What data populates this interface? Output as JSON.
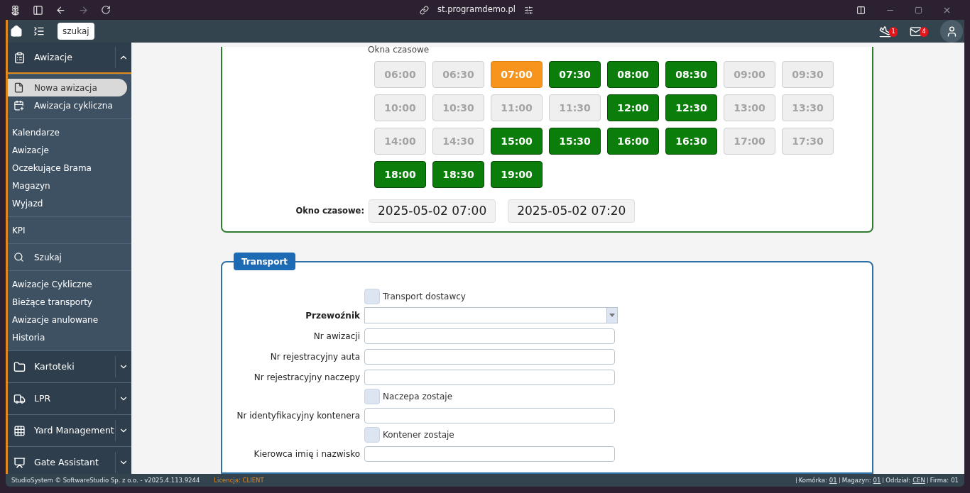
{
  "browser": {
    "url": "st.programdemo.pl"
  },
  "header": {
    "search_button": "szukaj",
    "notifications": [
      {
        "badge": "1"
      },
      {
        "badge": "4"
      }
    ]
  },
  "sidebar": {
    "groups": [
      {
        "items": [
          {
            "kind": "section",
            "label": "Awizacje",
            "expanded": true
          }
        ]
      },
      {
        "items": [
          {
            "kind": "icon_link",
            "label": "Nowa awizacja",
            "selected": true
          },
          {
            "kind": "icon_link",
            "label": "Awizacja cykliczna",
            "selected": false
          }
        ]
      },
      {
        "items": [
          {
            "kind": "link",
            "label": "Kalendarze",
            "selected": false
          },
          {
            "kind": "link",
            "label": "Awizacje",
            "selected": false
          },
          {
            "kind": "link",
            "label": "Oczekujące Brama",
            "selected": false
          },
          {
            "kind": "link",
            "label": "Magazyn",
            "selected": false
          },
          {
            "kind": "link",
            "label": "Wyjazd",
            "selected": false
          }
        ]
      },
      {
        "items": [
          {
            "kind": "link",
            "label": "KPI",
            "selected": false
          }
        ]
      },
      {
        "items": [
          {
            "kind": "icon_link",
            "label": "Szukaj",
            "selected": false
          }
        ]
      },
      {
        "items": [
          {
            "kind": "link",
            "label": "Awizacje Cykliczne",
            "selected": false
          },
          {
            "kind": "link",
            "label": "Bieżące transporty",
            "selected": false
          },
          {
            "kind": "link",
            "label": "Awizacje anulowane",
            "selected": false
          },
          {
            "kind": "link",
            "label": "Historia",
            "selected": false
          }
        ]
      },
      {
        "items": [
          {
            "kind": "section",
            "label": "Kartoteki",
            "expanded": false
          }
        ]
      },
      {
        "items": [
          {
            "kind": "section",
            "label": "LPR",
            "expanded": false
          }
        ]
      },
      {
        "items": [
          {
            "kind": "section",
            "label": "Yard Management",
            "expanded": false
          }
        ]
      },
      {
        "items": [
          {
            "kind": "section",
            "label": "Gate Assistant",
            "expanded": false
          }
        ]
      }
    ]
  },
  "time_windows": {
    "title": "Okna czasowe",
    "slots": [
      {
        "time": "06:00",
        "available": false,
        "selected": false
      },
      {
        "time": "06:30",
        "available": false,
        "selected": false
      },
      {
        "time": "07:00",
        "available": true,
        "selected": true
      },
      {
        "time": "07:30",
        "available": true,
        "selected": false
      },
      {
        "time": "08:00",
        "available": true,
        "selected": false
      },
      {
        "time": "08:30",
        "available": true,
        "selected": false
      },
      {
        "time": "09:00",
        "available": false,
        "selected": false
      },
      {
        "time": "09:30",
        "available": false,
        "selected": false
      },
      {
        "time": "10:00",
        "available": false,
        "selected": false
      },
      {
        "time": "10:30",
        "available": false,
        "selected": false
      },
      {
        "time": "11:00",
        "available": false,
        "selected": false
      },
      {
        "time": "11:30",
        "available": false,
        "selected": false
      },
      {
        "time": "12:00",
        "available": true,
        "selected": false
      },
      {
        "time": "12:30",
        "available": true,
        "selected": false
      },
      {
        "time": "13:00",
        "available": false,
        "selected": false
      },
      {
        "time": "13:30",
        "available": false,
        "selected": false
      },
      {
        "time": "14:00",
        "available": false,
        "selected": false
      },
      {
        "time": "14:30",
        "available": false,
        "selected": false
      },
      {
        "time": "15:00",
        "available": true,
        "selected": false
      },
      {
        "time": "15:30",
        "available": true,
        "selected": false
      },
      {
        "time": "16:00",
        "available": true,
        "selected": false
      },
      {
        "time": "16:30",
        "available": true,
        "selected": false
      },
      {
        "time": "17:00",
        "available": false,
        "selected": false
      },
      {
        "time": "17:30",
        "available": false,
        "selected": false
      },
      {
        "time": "18:00",
        "available": true,
        "selected": false
      },
      {
        "time": "18:30",
        "available": true,
        "selected": false
      },
      {
        "time": "19:00",
        "available": true,
        "selected": false
      }
    ],
    "window_label": "Okno czasowe:",
    "window_from": "2025-05-02 07:00",
    "window_to": "2025-05-02 07:20"
  },
  "transport": {
    "title": "Transport",
    "fields": [
      {
        "kind": "checkbox",
        "label": "Transport dostawcy",
        "checked": false
      },
      {
        "kind": "select",
        "label": "Przewoźnik",
        "required": true
      },
      {
        "kind": "text",
        "label": "Nr awizacji"
      },
      {
        "kind": "text",
        "label": "Nr rejestracyjny auta"
      },
      {
        "kind": "text",
        "label": "Nr rejestracyjny naczepy"
      },
      {
        "kind": "checkbox",
        "label": "Naczepa zostaje",
        "checked": false
      },
      {
        "kind": "text",
        "label": "Nr identyfikacyjny kontenera"
      },
      {
        "kind": "checkbox",
        "label": "Kontener zostaje",
        "checked": false
      },
      {
        "kind": "text",
        "label": "Kierowca imię i nazwisko"
      }
    ]
  },
  "status_bar": {
    "copyright": "StudioSystem © SoftwareStudio Sp. z o.o. - v2025.4.113.9244",
    "license": "Licencja: CLIENT",
    "info": [
      {
        "label": "Komórka:",
        "value": "01",
        "link": true
      },
      {
        "label": "Magazyn:",
        "value": "01",
        "link": true
      },
      {
        "label": "Oddział:",
        "value": "CEN",
        "link": true
      },
      {
        "label": "Firma:",
        "value": "01",
        "link": false
      }
    ]
  }
}
